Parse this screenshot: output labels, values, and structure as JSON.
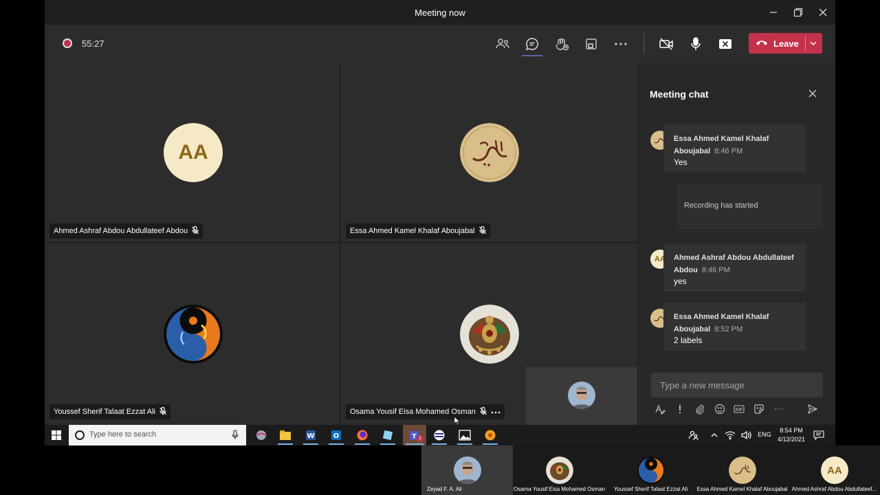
{
  "window": {
    "title": "Meeting now"
  },
  "toolbar": {
    "timer": "55:27",
    "leave_label": "Leave"
  },
  "participants": [
    {
      "name": "Ahmed Ashraf Abdou Abdullateef Abdou",
      "initials": "AA"
    },
    {
      "name": "Essa Ahmed Kamel Khalaf Aboujabal"
    },
    {
      "name": "Youssef Sherif Talaat Ezzat Ali"
    },
    {
      "name": "Osama Yousif Eisa Mohamed Osman"
    }
  ],
  "chat": {
    "title": "Meeting chat",
    "system_message": "Recording has started",
    "compose_placeholder": "Type a new message",
    "messages": [
      {
        "author": "Essa Ahmed Kamel Khalaf Aboujabal",
        "time": "8:46 PM",
        "text": "Yes"
      },
      {
        "author": "Ahmed Ashraf Abdou Abdullateef Abdou",
        "time": "8:46 PM",
        "text": "yes",
        "initials": "AA"
      },
      {
        "author": "Essa Ahmed Kamel Khalaf Aboujabal",
        "time": "8:52 PM",
        "text": "2 labels"
      }
    ]
  },
  "taskbar": {
    "search_placeholder": "Type here to search",
    "language": "ENG",
    "clock_time": "8:54 PM",
    "clock_date": "4/12/2021",
    "teams_badge": "1"
  },
  "filmstrip": [
    {
      "name": "Zeyad F. A. Ali"
    },
    {
      "name": "Osama Yousif Eisa Mohamed Osman"
    },
    {
      "name": "Youssef Sherif Talaat Ezzat Ali"
    },
    {
      "name": "Essa Ahmed Kamel Khalaf Aboujabal"
    },
    {
      "name": "Ahmed Ashraf Abdou Abdullateef...",
      "initials": "AA"
    }
  ],
  "colors": {
    "leave": "#c4314b",
    "accent": "#6264a7",
    "initials_bg": "#f5e9c7",
    "initials_fg": "#8b6716"
  }
}
